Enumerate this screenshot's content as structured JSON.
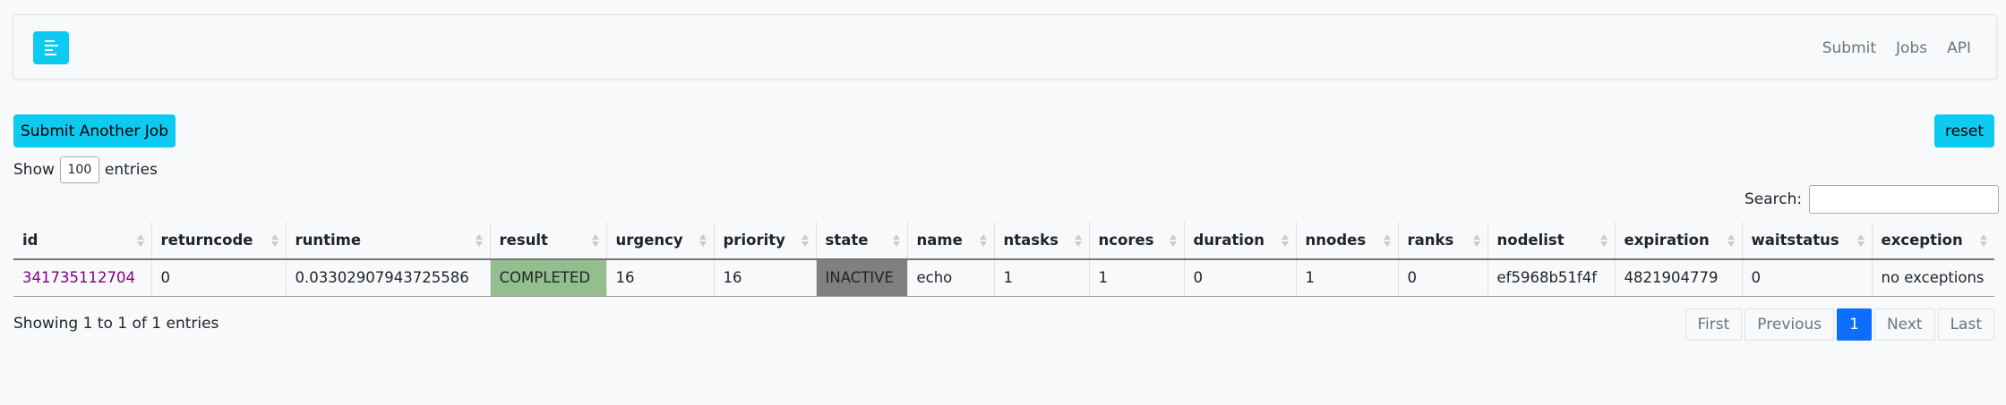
{
  "nav": {
    "links": [
      "Submit",
      "Jobs",
      "API"
    ]
  },
  "actions": {
    "submit_another": "Submit Another Job",
    "reset": "reset"
  },
  "length_menu": {
    "prefix": "Show",
    "value": "100",
    "suffix": "entries"
  },
  "search": {
    "label": "Search:",
    "value": ""
  },
  "table": {
    "columns": [
      "id",
      "returncode",
      "runtime",
      "result",
      "urgency",
      "priority",
      "state",
      "name",
      "ntasks",
      "ncores",
      "duration",
      "nnodes",
      "ranks",
      "nodelist",
      "expiration",
      "waitstatus",
      "exception"
    ],
    "rows": [
      [
        "341735112704",
        "0",
        "0.03302907943725586",
        "COMPLETED",
        "16",
        "16",
        "INACTIVE",
        "echo",
        "1",
        "1",
        "0",
        "1",
        "0",
        "ef5968b51f4f",
        "4821904779",
        "0",
        "no exceptions"
      ]
    ]
  },
  "status_colors": {
    "completed": "#93be8e",
    "inactive": "#808080",
    "link": "#800080",
    "accent": "#0dcaf0",
    "page_active": "#0d6efd"
  },
  "footer": {
    "info": "Showing 1 to 1 of 1 entries",
    "pagination": {
      "first": "First",
      "previous": "Previous",
      "current": "1",
      "next": "Next",
      "last": "Last"
    }
  }
}
